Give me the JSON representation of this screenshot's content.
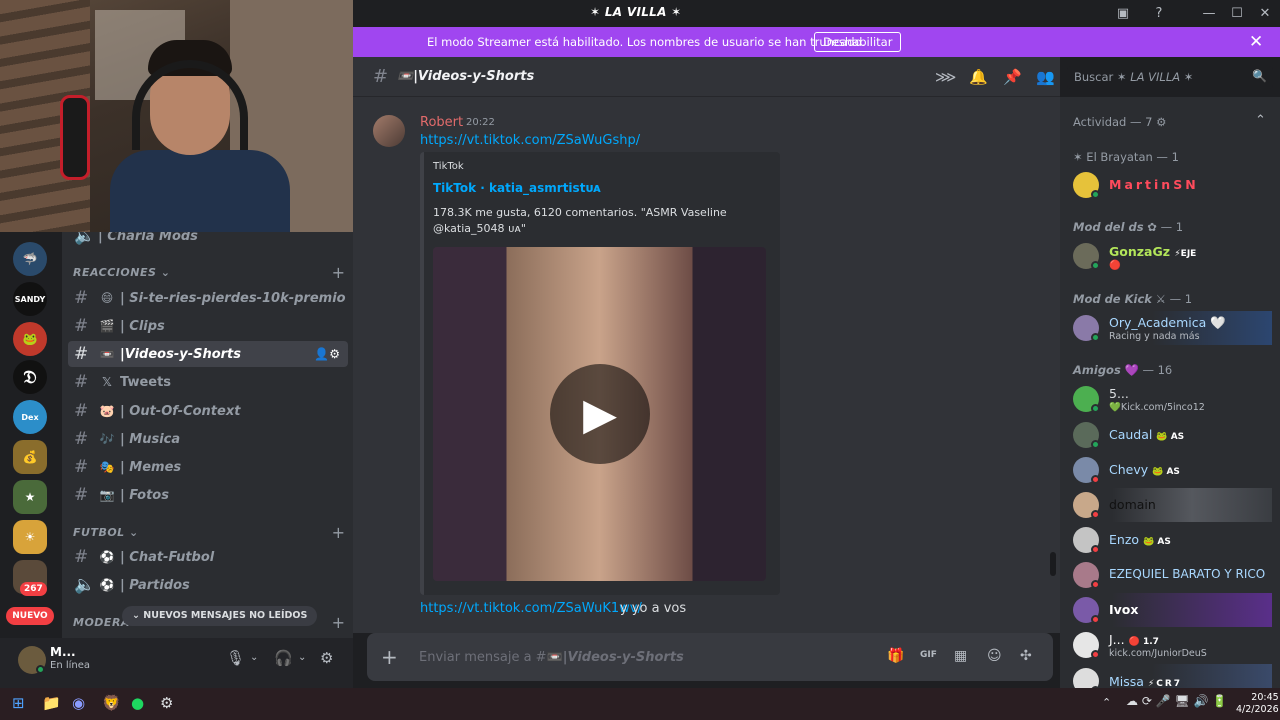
{
  "window": {
    "title": "LA VILLA"
  },
  "banner": {
    "message": "El modo Streamer está habilitado. Los nombres de usuario se han truncado.",
    "button": "Deshabilitar"
  },
  "channel_header": {
    "name": "|Videos-y-Shorts",
    "search_placeholder": "Buscar",
    "search_server": "LA VILLA"
  },
  "sidebar": {
    "partial_channel": "| Charla Mods",
    "categories": [
      {
        "label": "REACCIONES"
      },
      {
        "label": "FUTBOL"
      },
      {
        "label": "MODERA"
      }
    ],
    "channels": [
      {
        "label": "| Si-te-ries-pierdes-10k-premio"
      },
      {
        "label": "| Clips"
      },
      {
        "label": "|Videos-y-Shorts"
      },
      {
        "label": "Tweets"
      },
      {
        "label": "| Out-Of-Context"
      },
      {
        "label": "| Musica"
      },
      {
        "label": "| Memes"
      },
      {
        "label": "| Fotos"
      },
      {
        "label": "| Chat-Futbol"
      },
      {
        "label": "| Partidos"
      }
    ],
    "new_messages": "NUEVOS MENSAJES NO LEÍDOS",
    "nuevo_badge": "NUEVO",
    "server_badge": "267"
  },
  "user_panel": {
    "name": "M...",
    "status": "En línea"
  },
  "message": {
    "author": "Robert",
    "time": "20:22",
    "link": "https://vt.tiktok.com/ZSaWuGshp/",
    "embed": {
      "provider": "TikTok",
      "title": "TikTok · katia_asmrtistᴜᴀ",
      "description": "178.3K me gusta, 6120 comentarios. \"ASMR Vaseline @katia_5048 ᴜᴀ\""
    },
    "second_link": "https://vt.tiktok.com/ZSaWuK1wv/",
    "second_text": "y yo a vos"
  },
  "composer": {
    "placeholder_prefix": "Enviar mensaje a #",
    "placeholder_channel": "|Videos-y-Shorts"
  },
  "members": {
    "activity": "Actividad — 7",
    "sections": [
      {
        "label": "El Brayatan — 1"
      },
      {
        "label": "Mod del ds",
        "count": "— 1"
      },
      {
        "label": "Mod de Kick",
        "count": "— 1"
      },
      {
        "label": "Amigos",
        "count": "— 16"
      }
    ],
    "list": [
      {
        "name": "MartinSN",
        "sub": ""
      },
      {
        "name": "GonzaGz",
        "sub": "⚡EJE"
      },
      {
        "name": "Ory_Academica",
        "sub": "Racing y nada más"
      },
      {
        "name": "5...",
        "sub": "Kick.com/5inco12"
      },
      {
        "name": "Caudal",
        "sub": "AS"
      },
      {
        "name": "Chevy",
        "sub": "AS"
      },
      {
        "name": "domain",
        "sub": ""
      },
      {
        "name": "Enzo",
        "sub": "AS"
      },
      {
        "name": "EZEQUIEL BARATO Y RICO",
        "sub": ""
      },
      {
        "name": "Ivox",
        "sub": ""
      },
      {
        "name": "J...",
        "sub": "kick.com/JuniorDeuS",
        "tag": "1.7"
      },
      {
        "name": "Missa",
        "sub": "CR7"
      }
    ]
  },
  "taskbar": {
    "time": "20:45",
    "date": "4/2/2026"
  },
  "colors": {
    "banner": "#a046f0",
    "link": "#00a8fc",
    "author": "#e26b6b",
    "accent_red": "#f23f43"
  }
}
